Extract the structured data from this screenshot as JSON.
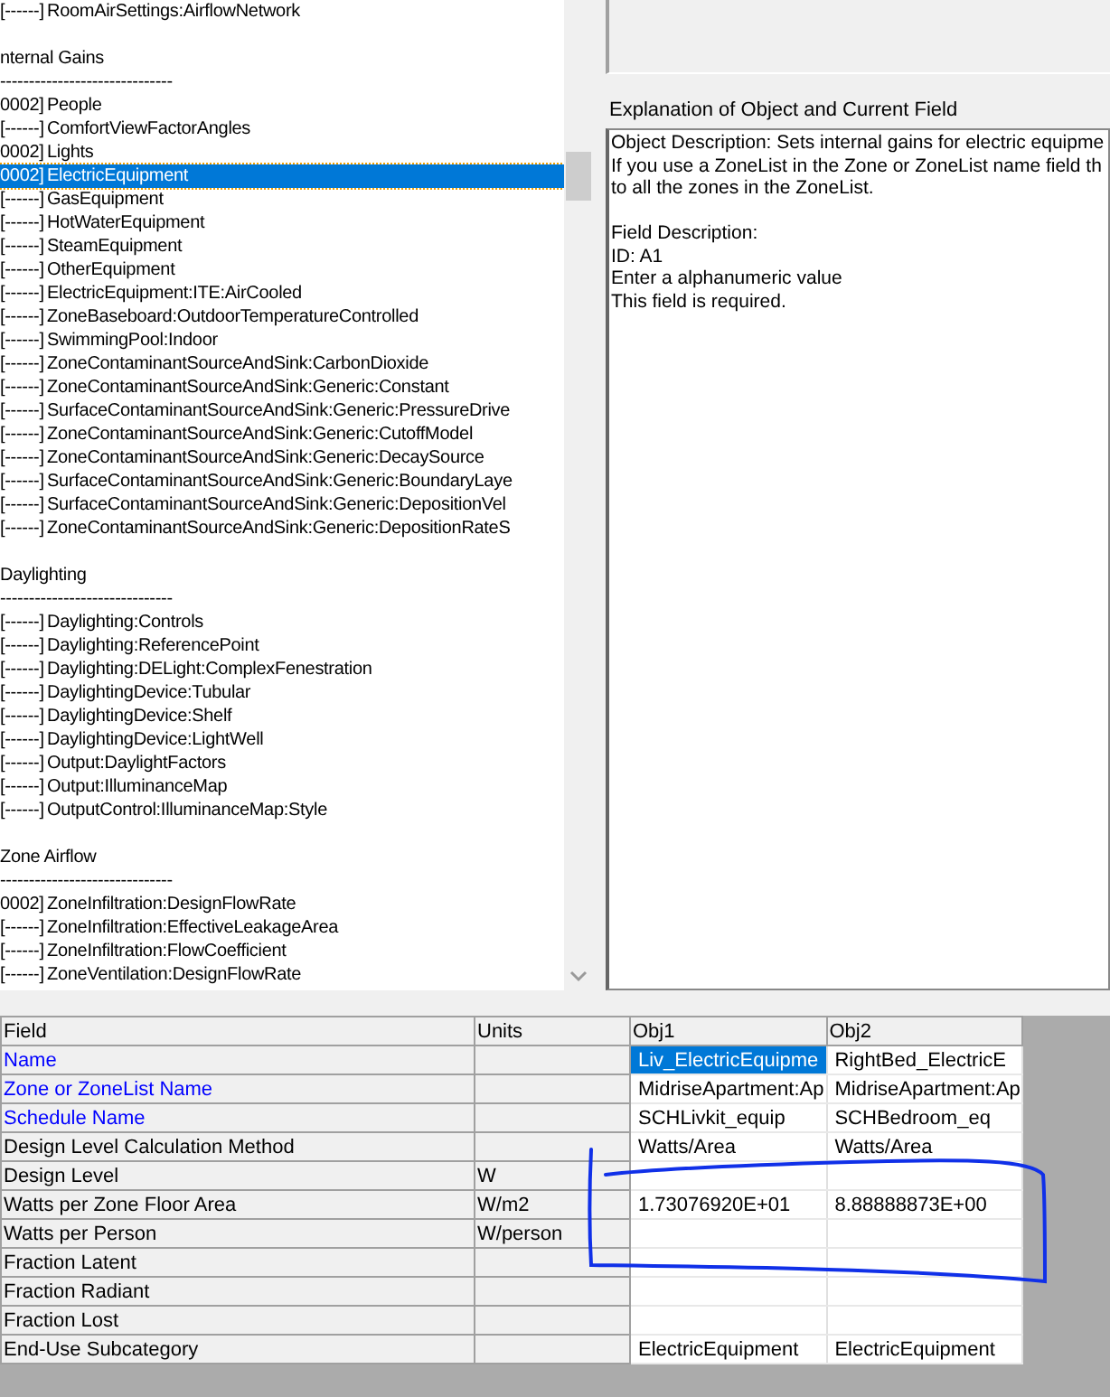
{
  "object_list": {
    "items": [
      {
        "kind": "object",
        "prefix": "[------]",
        "name": "RoomAirSettings:AirflowNetwork",
        "selected": false
      },
      {
        "kind": "blank"
      },
      {
        "kind": "group",
        "label": "nternal Gains"
      },
      {
        "kind": "separator",
        "text": "------------------------------"
      },
      {
        "kind": "object",
        "prefix": "0002]",
        "name": "People",
        "selected": false
      },
      {
        "kind": "object",
        "prefix": "[------]",
        "name": "ComfortViewFactorAngles",
        "selected": false
      },
      {
        "kind": "object",
        "prefix": "0002]",
        "name": "Lights",
        "selected": false
      },
      {
        "kind": "object",
        "prefix": "0002]",
        "name": "ElectricEquipment",
        "selected": true
      },
      {
        "kind": "object",
        "prefix": "[------]",
        "name": "GasEquipment",
        "selected": false
      },
      {
        "kind": "object",
        "prefix": "[------]",
        "name": "HotWaterEquipment",
        "selected": false
      },
      {
        "kind": "object",
        "prefix": "[------]",
        "name": "SteamEquipment",
        "selected": false
      },
      {
        "kind": "object",
        "prefix": "[------]",
        "name": "OtherEquipment",
        "selected": false
      },
      {
        "kind": "object",
        "prefix": "[------]",
        "name": "ElectricEquipment:ITE:AirCooled",
        "selected": false
      },
      {
        "kind": "object",
        "prefix": "[------]",
        "name": "ZoneBaseboard:OutdoorTemperatureControlled",
        "selected": false
      },
      {
        "kind": "object",
        "prefix": "[------]",
        "name": "SwimmingPool:Indoor",
        "selected": false
      },
      {
        "kind": "object",
        "prefix": "[------]",
        "name": "ZoneContaminantSourceAndSink:CarbonDioxide",
        "selected": false
      },
      {
        "kind": "object",
        "prefix": "[------]",
        "name": "ZoneContaminantSourceAndSink:Generic:Constant",
        "selected": false
      },
      {
        "kind": "object",
        "prefix": "[------]",
        "name": "SurfaceContaminantSourceAndSink:Generic:PressureDrive",
        "selected": false
      },
      {
        "kind": "object",
        "prefix": "[------]",
        "name": "ZoneContaminantSourceAndSink:Generic:CutoffModel",
        "selected": false
      },
      {
        "kind": "object",
        "prefix": "[------]",
        "name": "ZoneContaminantSourceAndSink:Generic:DecaySource",
        "selected": false
      },
      {
        "kind": "object",
        "prefix": "[------]",
        "name": "SurfaceContaminantSourceAndSink:Generic:BoundaryLaye",
        "selected": false
      },
      {
        "kind": "object",
        "prefix": "[------]",
        "name": "SurfaceContaminantSourceAndSink:Generic:DepositionVel",
        "selected": false
      },
      {
        "kind": "object",
        "prefix": "[------]",
        "name": "ZoneContaminantSourceAndSink:Generic:DepositionRateS",
        "selected": false
      },
      {
        "kind": "blank"
      },
      {
        "kind": "group",
        "label": "Daylighting"
      },
      {
        "kind": "separator",
        "text": "------------------------------"
      },
      {
        "kind": "object",
        "prefix": "[------]",
        "name": "Daylighting:Controls",
        "selected": false
      },
      {
        "kind": "object",
        "prefix": "[------]",
        "name": "Daylighting:ReferencePoint",
        "selected": false
      },
      {
        "kind": "object",
        "prefix": "[------]",
        "name": "Daylighting:DELight:ComplexFenestration",
        "selected": false
      },
      {
        "kind": "object",
        "prefix": "[------]",
        "name": "DaylightingDevice:Tubular",
        "selected": false
      },
      {
        "kind": "object",
        "prefix": "[------]",
        "name": "DaylightingDevice:Shelf",
        "selected": false
      },
      {
        "kind": "object",
        "prefix": "[------]",
        "name": "DaylightingDevice:LightWell",
        "selected": false
      },
      {
        "kind": "object",
        "prefix": "[------]",
        "name": "Output:DaylightFactors",
        "selected": false
      },
      {
        "kind": "object",
        "prefix": "[------]",
        "name": "Output:IlluminanceMap",
        "selected": false
      },
      {
        "kind": "object",
        "prefix": "[------]",
        "name": "OutputControl:IlluminanceMap:Style",
        "selected": false
      },
      {
        "kind": "blank"
      },
      {
        "kind": "group",
        "label": "Zone Airflow"
      },
      {
        "kind": "separator",
        "text": "------------------------------"
      },
      {
        "kind": "object",
        "prefix": "0002]",
        "name": "ZoneInfiltration:DesignFlowRate",
        "selected": false
      },
      {
        "kind": "object",
        "prefix": "[------]",
        "name": "ZoneInfiltration:EffectiveLeakageArea",
        "selected": false
      },
      {
        "kind": "object",
        "prefix": "[------]",
        "name": "ZoneInfiltration:FlowCoefficient",
        "selected": false
      },
      {
        "kind": "object",
        "prefix": "[------]",
        "name": "ZoneVentilation:DesignFlowRate",
        "selected": false
      }
    ]
  },
  "explanation": {
    "title": "Explanation of Object and Current Field",
    "paragraphs": [
      [
        "Object Description: Sets internal gains for electric equipme",
        "If you use a ZoneList in the Zone or ZoneList name field th",
        "to all the zones in the ZoneList."
      ],
      [
        "Field Description:",
        "ID: A1",
        "Enter a alphanumeric value",
        "This field is required."
      ]
    ]
  },
  "table": {
    "columns": [
      "Field",
      "Units",
      "Obj1",
      "Obj2"
    ],
    "rows": [
      {
        "field": "Name",
        "required": true,
        "values": [
          {
            "text": "Liv_ElectricEquipme",
            "selected": true
          },
          {
            "text": "RightBed_ElectricE",
            "selected": false
          }
        ]
      },
      {
        "field": "Zone or ZoneList Name",
        "required": true,
        "values": [
          {
            "text": "MidriseApartment:Ap",
            "selected": false
          },
          {
            "text": "MidriseApartment:Ap",
            "selected": false
          }
        ]
      },
      {
        "field": "Schedule Name",
        "required": true,
        "values": [
          {
            "text": "SCHLivkit_equip",
            "selected": false
          },
          {
            "text": "SCHBedroom_eq",
            "selected": false
          }
        ]
      },
      {
        "field": "Design Level Calculation Method",
        "required": false,
        "values": [
          {
            "text": "Watts/Area",
            "selected": false
          },
          {
            "text": "Watts/Area",
            "selected": false
          }
        ]
      },
      {
        "field": "Design Level",
        "required": false,
        "units": "W",
        "values": [
          {
            "selected": false
          },
          {
            "selected": false
          }
        ]
      },
      {
        "field": "Watts per Zone Floor Area",
        "required": false,
        "units": "W/m2",
        "values": [
          {
            "text": "1.73076920E+01",
            "selected": false
          },
          {
            "text": "8.88888873E+00",
            "selected": false
          }
        ]
      },
      {
        "field": "Watts per Person",
        "required": false,
        "units": "W/person",
        "values": [
          {
            "selected": false
          },
          {
            "selected": false
          }
        ]
      },
      {
        "field": "Fraction Latent",
        "required": false,
        "values": [
          {
            "selected": false
          },
          {
            "selected": false
          }
        ]
      },
      {
        "field": "Fraction Radiant",
        "required": false,
        "values": [
          {
            "selected": false
          },
          {
            "selected": false
          }
        ]
      },
      {
        "field": "Fraction Lost",
        "required": false,
        "values": [
          {
            "selected": false
          },
          {
            "selected": false
          }
        ]
      },
      {
        "field": "End-Use Subcategory",
        "required": false,
        "values": [
          {
            "text": "ElectricEquipment",
            "selected": false
          },
          {
            "text": "ElectricEquipment",
            "selected": false
          }
        ]
      }
    ]
  }
}
